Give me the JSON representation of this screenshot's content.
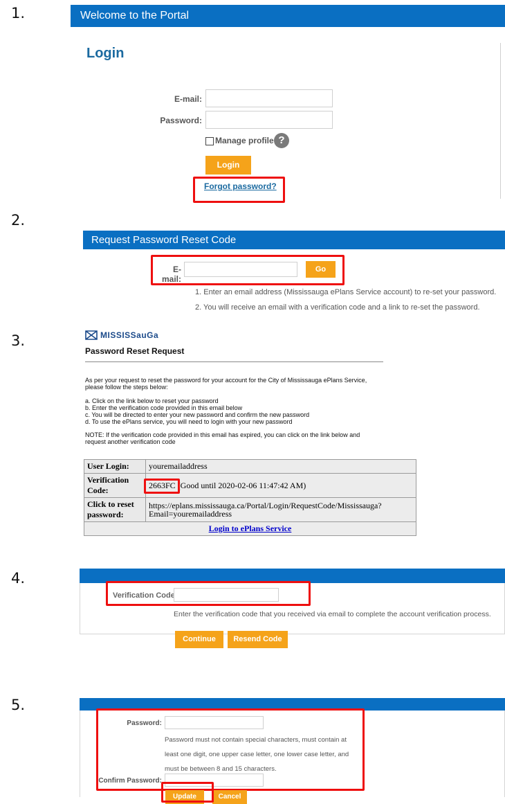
{
  "steps": [
    "1.",
    "2.",
    "3.",
    "4.",
    "5."
  ],
  "colors": {
    "bar_blue": "#0a6fc2",
    "button_orange": "#f5a31a",
    "highlight_red": "#ee0f0f",
    "login_title": "#1b6aa0"
  },
  "s1": {
    "bar_title": "Welcome to the Portal",
    "heading": "Login",
    "email_label": "E-mail:",
    "password_label": "Password:",
    "manage_profile": "Manage profile",
    "help_icon": "question-circle-icon",
    "login_button": "Login",
    "forgot_link": "Forgot password?"
  },
  "s2": {
    "bar_title": "Request Password Reset Code",
    "email_label": "E-mail:",
    "go_button": "Go",
    "note1": "1. Enter an email address (Mississauga ePlans Service account) to re-set your password.",
    "note2": "2. You will receive an email with a verification code and a link to re-set the password."
  },
  "s3": {
    "logo_icon": "mississauga-logo-icon",
    "logo_text": "MISSISSauGa",
    "title": "Password Reset Request",
    "intro1": "As per your request to reset the password for your account for the City of Mississauga ePlans Service,",
    "intro2": "please follow the steps below:",
    "step_a": "a. Click on the link below to reset your password",
    "step_b": "b. Enter the verification code provided in this email below",
    "step_c": "c. You will be directed to enter your new password and confirm the new password",
    "step_d": "d. To use the ePlans service, you will need to login with your new password",
    "note1": "NOTE: If the verification code provided in this email has expired, you can click on the link below and",
    "note2": "request another verification code",
    "row1_label": "User Login:",
    "row1_value": "youremailaddress",
    "row2_label": "Verification Code:",
    "row2_code": "2663FC",
    "row2_rest": " (Good until 2020-02-06 11:47:42 AM)",
    "row3_label": "Click to reset password:",
    "row3_value1": "https://eplans.mississauga.ca/Portal/Login/RequestCode/Mississauga?",
    "row3_value2": "Email=youremailaddress",
    "login_link": "Login to ePlans Service"
  },
  "s4": {
    "code_label": "Verification Code",
    "required": "*",
    "hint": "Enter the verification code that you received via email to complete the account verification process.",
    "continue_button": "Continue",
    "resend_button": "Resend Code"
  },
  "s5": {
    "password_label": "Password:",
    "help1": "Password must not contain special characters, must contain at",
    "help2": "least one digit, one upper case letter, one lower case letter, and",
    "help3": "must be between 8 and 15 characters.",
    "confirm_label": "Confirm Password:",
    "update_button": "Update",
    "cancel_button": "Cancel"
  }
}
